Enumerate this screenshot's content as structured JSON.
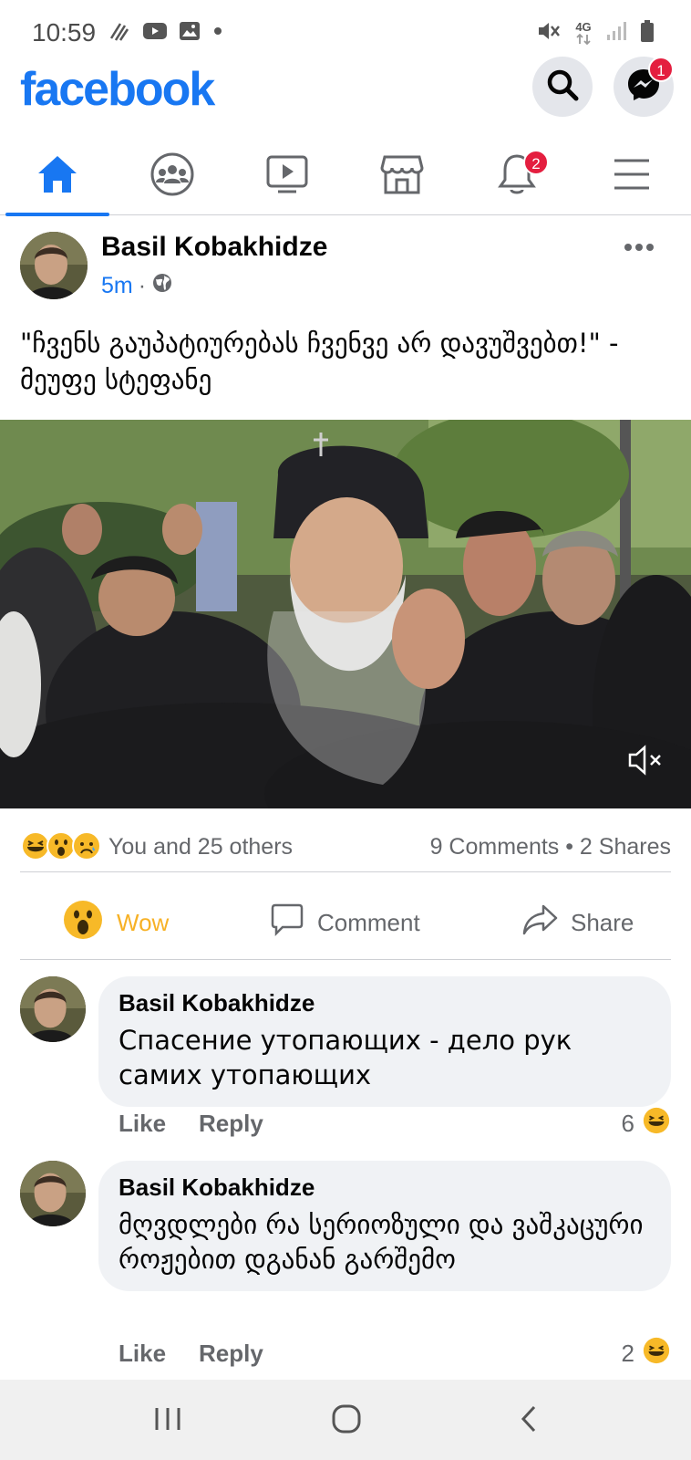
{
  "status_bar": {
    "time": "10:59",
    "network": "4G",
    "icons_left": [
      "wifi-calling-icon",
      "youtube-icon",
      "gallery-icon",
      "dot-icon"
    ],
    "icons_right": [
      "mute-icon",
      "network-4g-icon",
      "signal-icon",
      "battery-icon"
    ]
  },
  "header": {
    "brand": "facebook",
    "messenger_badge": "1",
    "brand_color": "#1877f2"
  },
  "tabs": [
    {
      "name": "home",
      "icon": "home-icon",
      "active": true
    },
    {
      "name": "groups",
      "icon": "groups-icon",
      "active": false
    },
    {
      "name": "watch",
      "icon": "video-icon",
      "active": false
    },
    {
      "name": "marketplace",
      "icon": "marketplace-icon",
      "active": false
    },
    {
      "name": "notifications",
      "icon": "bell-icon",
      "active": false,
      "badge": "2"
    },
    {
      "name": "menu",
      "icon": "hamburger-icon",
      "active": false
    }
  ],
  "post": {
    "author": "Basil Kobakhidze",
    "time": "5m",
    "separator": "·",
    "privacy_icon": "globe-icon",
    "text": "\"ჩვენს გაუპატიურებას ჩვენვე არ დავუშვებთ!\" - მეუფე სტეფანე",
    "reactions_summary": "You and 25 others",
    "counts": "9 Comments • 2 Shares",
    "actions": {
      "wow": "Wow",
      "comment": "Comment",
      "share": "Share"
    }
  },
  "comments": [
    {
      "author": "Basil Kobakhidze",
      "text": "Спасение утопающих - дело рук самих утопающих",
      "like": "Like",
      "reply": "Reply",
      "reaction_count": "6"
    },
    {
      "author": "Basil Kobakhidze",
      "text": "მღვდლები რა სერიოზული და ვაშკაცური როჟებით დგანან გარშემო",
      "like": "Like",
      "reply": "Reply",
      "reaction_count": "2"
    }
  ]
}
